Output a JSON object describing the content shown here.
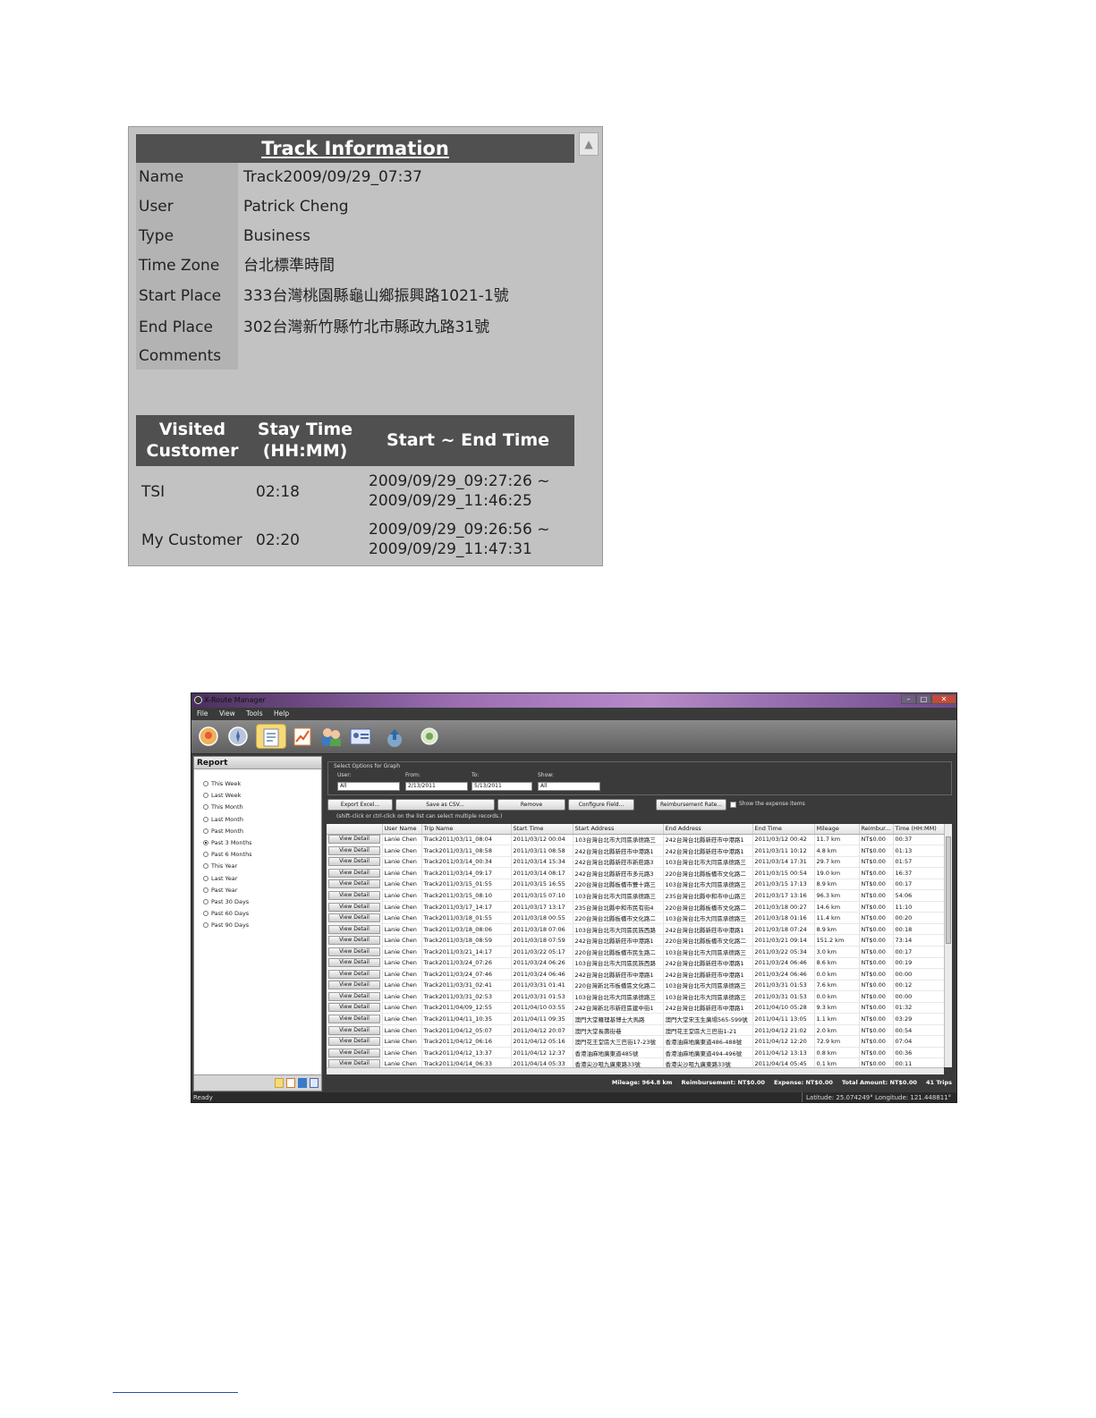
{
  "track_info": {
    "title": "Track Information",
    "fields": [
      {
        "label": "Name",
        "value": "Track2009/09/29_07:37"
      },
      {
        "label": "User",
        "value": "Patrick Cheng"
      },
      {
        "label": "Type",
        "value": "Business"
      },
      {
        "label": "Time Zone",
        "value": "台北標準時間"
      },
      {
        "label": "Start Place",
        "value": "333台灣桃園縣龜山鄉振興路1021-1號"
      },
      {
        "label": "End Place",
        "value": "302台灣新竹縣竹北市縣政九路31號"
      },
      {
        "label": "Comments",
        "value": ""
      }
    ],
    "visited_headers": {
      "customer_1": "Visited",
      "customer_2": "Customer",
      "stay_1": "Stay Time",
      "stay_2": "(HH:MM)",
      "range": "Start ~ End Time"
    },
    "visits": [
      {
        "customer": "TSI",
        "stay": "02:18",
        "start": "2009/09/29_09:27:26 ~",
        "end": "2009/09/29_11:46:25"
      },
      {
        "customer": "My Customer",
        "stay": "02:20",
        "start": "2009/09/29_09:26:56 ~",
        "end": "2009/09/29_11:47:31"
      }
    ]
  },
  "app": {
    "title": "X-Route Manager",
    "menu": [
      "File",
      "View",
      "Tools",
      "Help"
    ],
    "report": {
      "heading": "Report",
      "options": [
        "This Week",
        "Last Week",
        "This Month",
        "Last Month",
        "Past Month",
        "Past 3 Months",
        "Past 6 Months",
        "This Year",
        "Last Year",
        "Past Year",
        "Past 30 Days",
        "Past 60 Days",
        "Past 90 Days"
      ],
      "selected": "Past 3 Months"
    },
    "graph_options": {
      "legend": "Select Options for Graph",
      "user_label": "User:",
      "user_value": "All",
      "from_label": "From:",
      "from_value": "2/13/2011",
      "to_label": "To:",
      "to_value": "5/13/2011",
      "show_label": "Show:",
      "show_value": "All"
    },
    "buttons": {
      "export_excel": "Export Excel...",
      "save_csv": "Save as CSV...",
      "remove": "Remove",
      "configure": "Configure Field...",
      "reimbursement": "Reimbursement Rate...",
      "show_expense": "Show the expense items"
    },
    "hint": "(shift-click or ctrl-click on the list can select multiple records.)",
    "columns": [
      "",
      "User Name",
      "Trip Name",
      "Start Time",
      "Start Address",
      "End Address",
      "End Time",
      "Mileage",
      "Reimbur...",
      "Time (HH:MM)"
    ],
    "view_detail_label": "View Detail",
    "rows": [
      [
        "Lanie Chen",
        "Track2011/03/11_08:04",
        "2011/03/12 00:04",
        "103台灣台北市大同區承德路三",
        "242台灣台北縣新莊市中港路1",
        "2011/03/12 00:42",
        "11.7 km",
        "NT$0.00",
        "00:37"
      ],
      [
        "Lanie Chen",
        "Track2011/03/11_08:58",
        "2011/03/11 08:58",
        "242台灣台北縣新莊市中港路1",
        "242台灣台北縣新莊市中港路1",
        "2011/03/11 10:12",
        "4.8 km",
        "NT$0.00",
        "01:13"
      ],
      [
        "Lanie Chen",
        "Track2011/03/14_00:34",
        "2011/03/14 15:34",
        "242台灣台北縣新莊市新莊路3",
        "103台灣台北市大同區承德路三",
        "2011/03/14 17:31",
        "29.7 km",
        "NT$0.00",
        "01:57"
      ],
      [
        "Lanie Chen",
        "Track2011/03/14_09:17",
        "2011/03/14 08:17",
        "242台灣台北縣新莊市多元路3",
        "220台灣台北縣板橋市文化路二",
        "2011/03/15 00:54",
        "19.0 km",
        "NT$0.00",
        "16:37"
      ],
      [
        "Lanie Chen",
        "Track2011/03/15_01:55",
        "2011/03/15 16:55",
        "220台灣台北縣板橋市雙十路三",
        "103台灣台北市大同區承德路三",
        "2011/03/15 17:13",
        "8.9 km",
        "NT$0.00",
        "00:17"
      ],
      [
        "Lanie Chen",
        "Track2011/03/15_08:10",
        "2011/03/15 07:10",
        "103台灣台北市大同區承德路三",
        "235台灣台北縣中和市中山路三",
        "2011/03/17 13:16",
        "96.3 km",
        "NT$0.00",
        "54:06"
      ],
      [
        "Lanie Chen",
        "Track2011/03/17_14:17",
        "2011/03/17 13:17",
        "235台灣台北縣中和市民有街4",
        "220台灣台北縣板橋市文化路二",
        "2011/03/18 00:27",
        "14.6 km",
        "NT$0.00",
        "11:10"
      ],
      [
        "Lanie Chen",
        "Track2011/03/18_01:55",
        "2011/03/18 00:55",
        "220台灣台北縣板橋市文化路二",
        "103台灣台北市大同區承德路三",
        "2011/03/18 01:16",
        "11.4 km",
        "NT$0.00",
        "00:20"
      ],
      [
        "Lanie Chen",
        "Track2011/03/18_08:06",
        "2011/03/18 07:06",
        "103台灣台北市大同區民族西路",
        "242台灣台北縣新莊市中港路1",
        "2011/03/18 07:24",
        "8.9 km",
        "NT$0.00",
        "00:18"
      ],
      [
        "Lanie Chen",
        "Track2011/03/18_08:59",
        "2011/03/18 07:59",
        "242台灣台北縣新莊市中港路1",
        "220台灣台北縣板橋市文化路二",
        "2011/03/21 09:14",
        "151.2 km",
        "NT$0.00",
        "73:14"
      ],
      [
        "Lanie Chen",
        "Track2011/03/21_14:17",
        "2011/03/22 05:17",
        "220台灣台北縣板橋市民生路二",
        "103台灣台北市大同區承德路三",
        "2011/03/22 05:34",
        "3.0 km",
        "NT$0.00",
        "00:17"
      ],
      [
        "Lanie Chen",
        "Track2011/03/24_07:26",
        "2011/03/24 06:26",
        "103台灣台北市大同區民族西路",
        "242台灣台北縣新莊市中港路1",
        "2011/03/24 06:46",
        "8.6 km",
        "NT$0.00",
        "00:19"
      ],
      [
        "Lanie Chen",
        "Track2011/03/24_07:46",
        "2011/03/24 06:46",
        "242台灣台北縣新莊市中港路1",
        "242台灣台北縣新莊市中港路1",
        "2011/03/24 06:46",
        "0.0 km",
        "NT$0.00",
        "00:00"
      ],
      [
        "Lanie Chen",
        "Track2011/03/31_02:41",
        "2011/03/31 01:41",
        "220台灣新北市板橋區文化路二",
        "103台灣台北市大同區承德路三",
        "2011/03/31 01:53",
        "7.6 km",
        "NT$0.00",
        "00:12"
      ],
      [
        "Lanie Chen",
        "Track2011/03/31_02:53",
        "2011/03/31 01:53",
        "103台灣台北市大同區承德路三",
        "103台灣台北市大同區承德路三",
        "2011/03/31 01:53",
        "0.0 km",
        "NT$0.00",
        "00:00"
      ],
      [
        "Lanie Chen",
        "Track2011/04/09_12:55",
        "2011/04/10 03:55",
        "242台灣新北市新莊區建中街1",
        "242台灣台北縣新莊市中港路1",
        "2011/04/10 05:28",
        "9.3 km",
        "NT$0.00",
        "01:32"
      ],
      [
        "Lanie Chen",
        "Track2011/04/11_10:35",
        "2011/04/11 09:35",
        "澳門大堂羅理基博士大馬路",
        "澳門大堂宋玉生廣場565-599號",
        "2011/04/11 13:05",
        "1.1 km",
        "NT$0.00",
        "03:29"
      ],
      [
        "Lanie Chen",
        "Track2011/04/12_05:07",
        "2011/04/12 20:07",
        "澳門大堂長壽街巷",
        "澳門花王堂區大三巴街1-21",
        "2011/04/12 21:02",
        "2.0 km",
        "NT$0.00",
        "00:54"
      ],
      [
        "Lanie Chen",
        "Track2011/04/12_06:16",
        "2011/04/12 05:16",
        "澳門花王堂區大三巴街17-23號",
        "香港油麻地廣東道486-488號",
        "2011/04/12 12:20",
        "72.9 km",
        "NT$0.00",
        "07:04"
      ],
      [
        "Lanie Chen",
        "Track2011/04/12_13:37",
        "2011/04/12 12:37",
        "香港油麻地廣東道485號",
        "香港油麻地廣東道494-496號",
        "2011/04/12 13:13",
        "0.8 km",
        "NT$0.00",
        "00:36"
      ],
      [
        "Lanie Chen",
        "Track2011/04/14_06:33",
        "2011/04/14 05:33",
        "香港尖沙咀九廣東路33號",
        "香港尖沙咀九廣東路33號",
        "2011/04/14 05:45",
        "0.1 km",
        "NT$0.00",
        "00:11"
      ]
    ],
    "summary": {
      "mileage": "Mileage: 964.8 km",
      "reimbursement": "Reimbursement: NT$0.00",
      "expense": "Expense: NT$0.00",
      "total": "Total Amount: NT$0.00",
      "trips": "41 Trips"
    },
    "status": {
      "ready": "Ready",
      "coords": "Latitude: 25.074249°  Longitude: 121.448811°"
    }
  }
}
